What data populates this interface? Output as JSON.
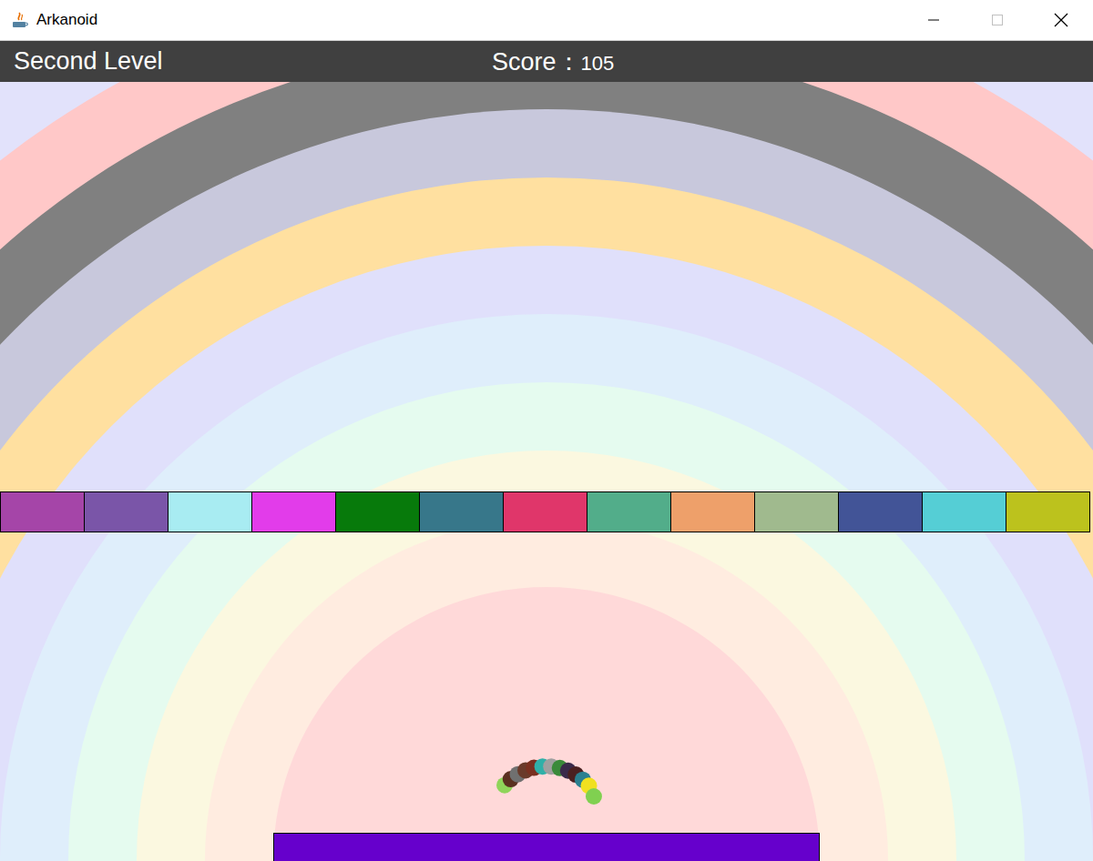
{
  "window": {
    "title": "Arkanoid"
  },
  "hud": {
    "level": "Second Level",
    "score_label": "Score：",
    "score": "105"
  },
  "blocks": [
    {
      "color": "#a545a8"
    },
    {
      "color": "#7a55a8"
    },
    {
      "color": "#a8ecf2"
    },
    {
      "color": "#e23cea"
    },
    {
      "color": "#077a0b"
    },
    {
      "color": "#37778a"
    },
    {
      "color": "#e0366a"
    },
    {
      "color": "#52ad8a"
    },
    {
      "color": "#eea06a"
    },
    {
      "color": "#a0ba8e"
    },
    {
      "color": "#425497"
    },
    {
      "color": "#55ced5"
    },
    {
      "color": "#bcc21d"
    }
  ],
  "balls": [
    {
      "color": "#8fd45a"
    },
    {
      "color": "#5a3020"
    },
    {
      "color": "#707070"
    },
    {
      "color": "#6a3a2a"
    },
    {
      "color": "#7a3020"
    },
    {
      "color": "#30b0a8"
    },
    {
      "color": "#a0a0a0"
    },
    {
      "color": "#3a8a3a"
    },
    {
      "color": "#3a2a4a"
    },
    {
      "color": "#4a2020"
    },
    {
      "color": "#2a8090"
    },
    {
      "color": "#f0e020"
    },
    {
      "color": "#80d050"
    }
  ]
}
